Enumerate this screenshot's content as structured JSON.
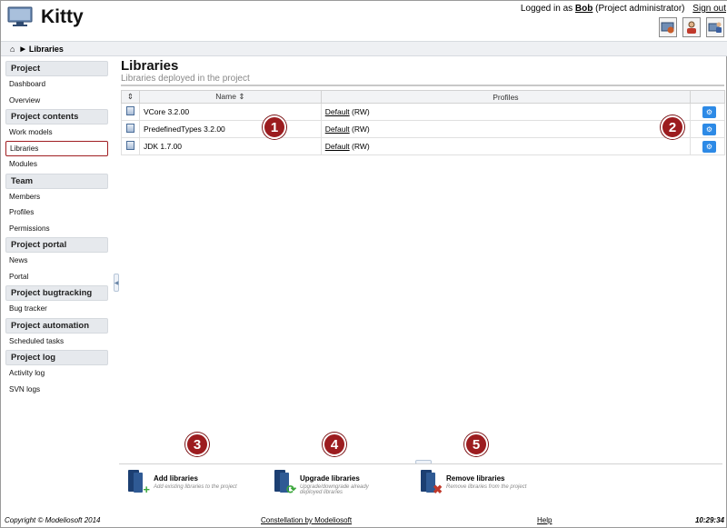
{
  "app": {
    "title": "Kitty"
  },
  "user": {
    "prefix": "Logged in as",
    "name": "Bob",
    "role": "(Project administrator)",
    "signout": "Sign out"
  },
  "breadcrumb": {
    "current": "Libraries"
  },
  "sidebar": {
    "sections": [
      {
        "title": "Project",
        "items": [
          "Dashboard",
          "Overview"
        ]
      },
      {
        "title": "Project contents",
        "items": [
          "Work models",
          "Libraries",
          "Modules"
        ]
      },
      {
        "title": "Team",
        "items": [
          "Members",
          "Profiles",
          "Permissions"
        ]
      },
      {
        "title": "Project portal",
        "items": [
          "News",
          "Portal"
        ]
      },
      {
        "title": "Project bugtracking",
        "items": [
          "Bug tracker"
        ]
      },
      {
        "title": "Project automation",
        "items": [
          "Scheduled tasks"
        ]
      },
      {
        "title": "Project log",
        "items": [
          "Activity log",
          "SVN logs"
        ]
      }
    ],
    "active_item": "Libraries"
  },
  "main": {
    "title": "Libraries",
    "subtitle": "Libraries deployed in the project",
    "table": {
      "headers": {
        "name": "Name",
        "profiles": "Profiles"
      },
      "rows": [
        {
          "name": "VCore 3.2.00",
          "profile": "Default",
          "access": "(RW)"
        },
        {
          "name": "PredefinedTypes 3.2.00",
          "profile": "Default",
          "access": "(RW)"
        },
        {
          "name": "JDK 1.7.00",
          "profile": "Default",
          "access": "(RW)"
        }
      ]
    }
  },
  "callouts": [
    "1",
    "2",
    "3",
    "4",
    "5"
  ],
  "actions": [
    {
      "label": "Add libraries",
      "desc": "Add existing libraries to the project",
      "badge": "+",
      "badge_color": "#3aa63a"
    },
    {
      "label": "Upgrade libraries",
      "desc": "Upgrade/downgrade already deployed libraries",
      "badge": "⟳",
      "badge_color": "#3aa63a"
    },
    {
      "label": "Remove libraries",
      "desc": "Remove libraries from the project",
      "badge": "✖",
      "badge_color": "#c0392b"
    }
  ],
  "footer": {
    "copyright": "Copyright © Modeliosoft 2014",
    "constellation": "Constellation by Modeliosoft",
    "help": "Help",
    "time": "10:29:34"
  },
  "colors": {
    "accent": "#9c1c1f",
    "button_blue": "#2d8ae6",
    "section_bg": "#e6e9ed"
  }
}
